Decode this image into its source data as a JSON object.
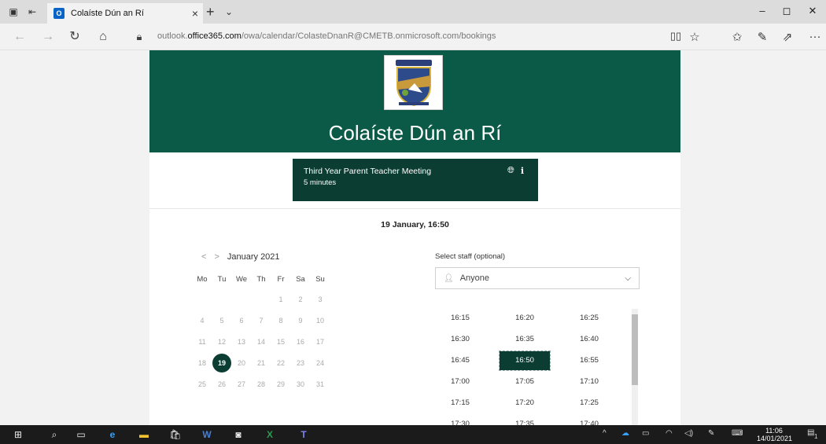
{
  "browser": {
    "tab_title": "Colaíste Dún an Rí",
    "tab_favicon": "O",
    "url_prefix": "outlook.",
    "url_domain": "office365.com",
    "url_path": "/owa/calendar/ColasteDnanR@CMETB.onmicrosoft.com/bookings"
  },
  "header": {
    "school_name": "Colaíste Dún an Rí",
    "brand_color": "#0b5a47"
  },
  "service": {
    "name": "Third Year Parent Teacher Meeting",
    "duration": "5 minutes",
    "icons": [
      "globe-icon",
      "info-icon"
    ],
    "info_glyph": "i"
  },
  "selected_datetime": "19 January, 16:50",
  "calendar": {
    "month": "January 2021",
    "weekdays": [
      "Mo",
      "Tu",
      "We",
      "Th",
      "Fr",
      "Sa",
      "Su"
    ],
    "weeks": [
      [
        "",
        "",
        "",
        "",
        "1",
        "2",
        "3"
      ],
      [
        "4",
        "5",
        "6",
        "7",
        "8",
        "9",
        "10"
      ],
      [
        "11",
        "12",
        "13",
        "14",
        "15",
        "16",
        "17"
      ],
      [
        "18",
        "19",
        "20",
        "21",
        "22",
        "23",
        "24"
      ],
      [
        "25",
        "26",
        "27",
        "28",
        "29",
        "30",
        "31"
      ]
    ],
    "selected_day": "19"
  },
  "staff": {
    "label": "Select staff (optional)",
    "value": "Anyone"
  },
  "time_slots": [
    [
      "16:15",
      "16:20",
      "16:25"
    ],
    [
      "16:30",
      "16:35",
      "16:40"
    ],
    [
      "16:45",
      "16:50",
      "16:55"
    ],
    [
      "17:00",
      "17:05",
      "17:10"
    ],
    [
      "17:15",
      "17:20",
      "17:25"
    ],
    [
      "17:30",
      "17:35",
      "17:40"
    ]
  ],
  "selected_slot": "16:50",
  "taskbar": {
    "time": "11:06",
    "date": "14/01/2021",
    "notification_count": "1"
  }
}
